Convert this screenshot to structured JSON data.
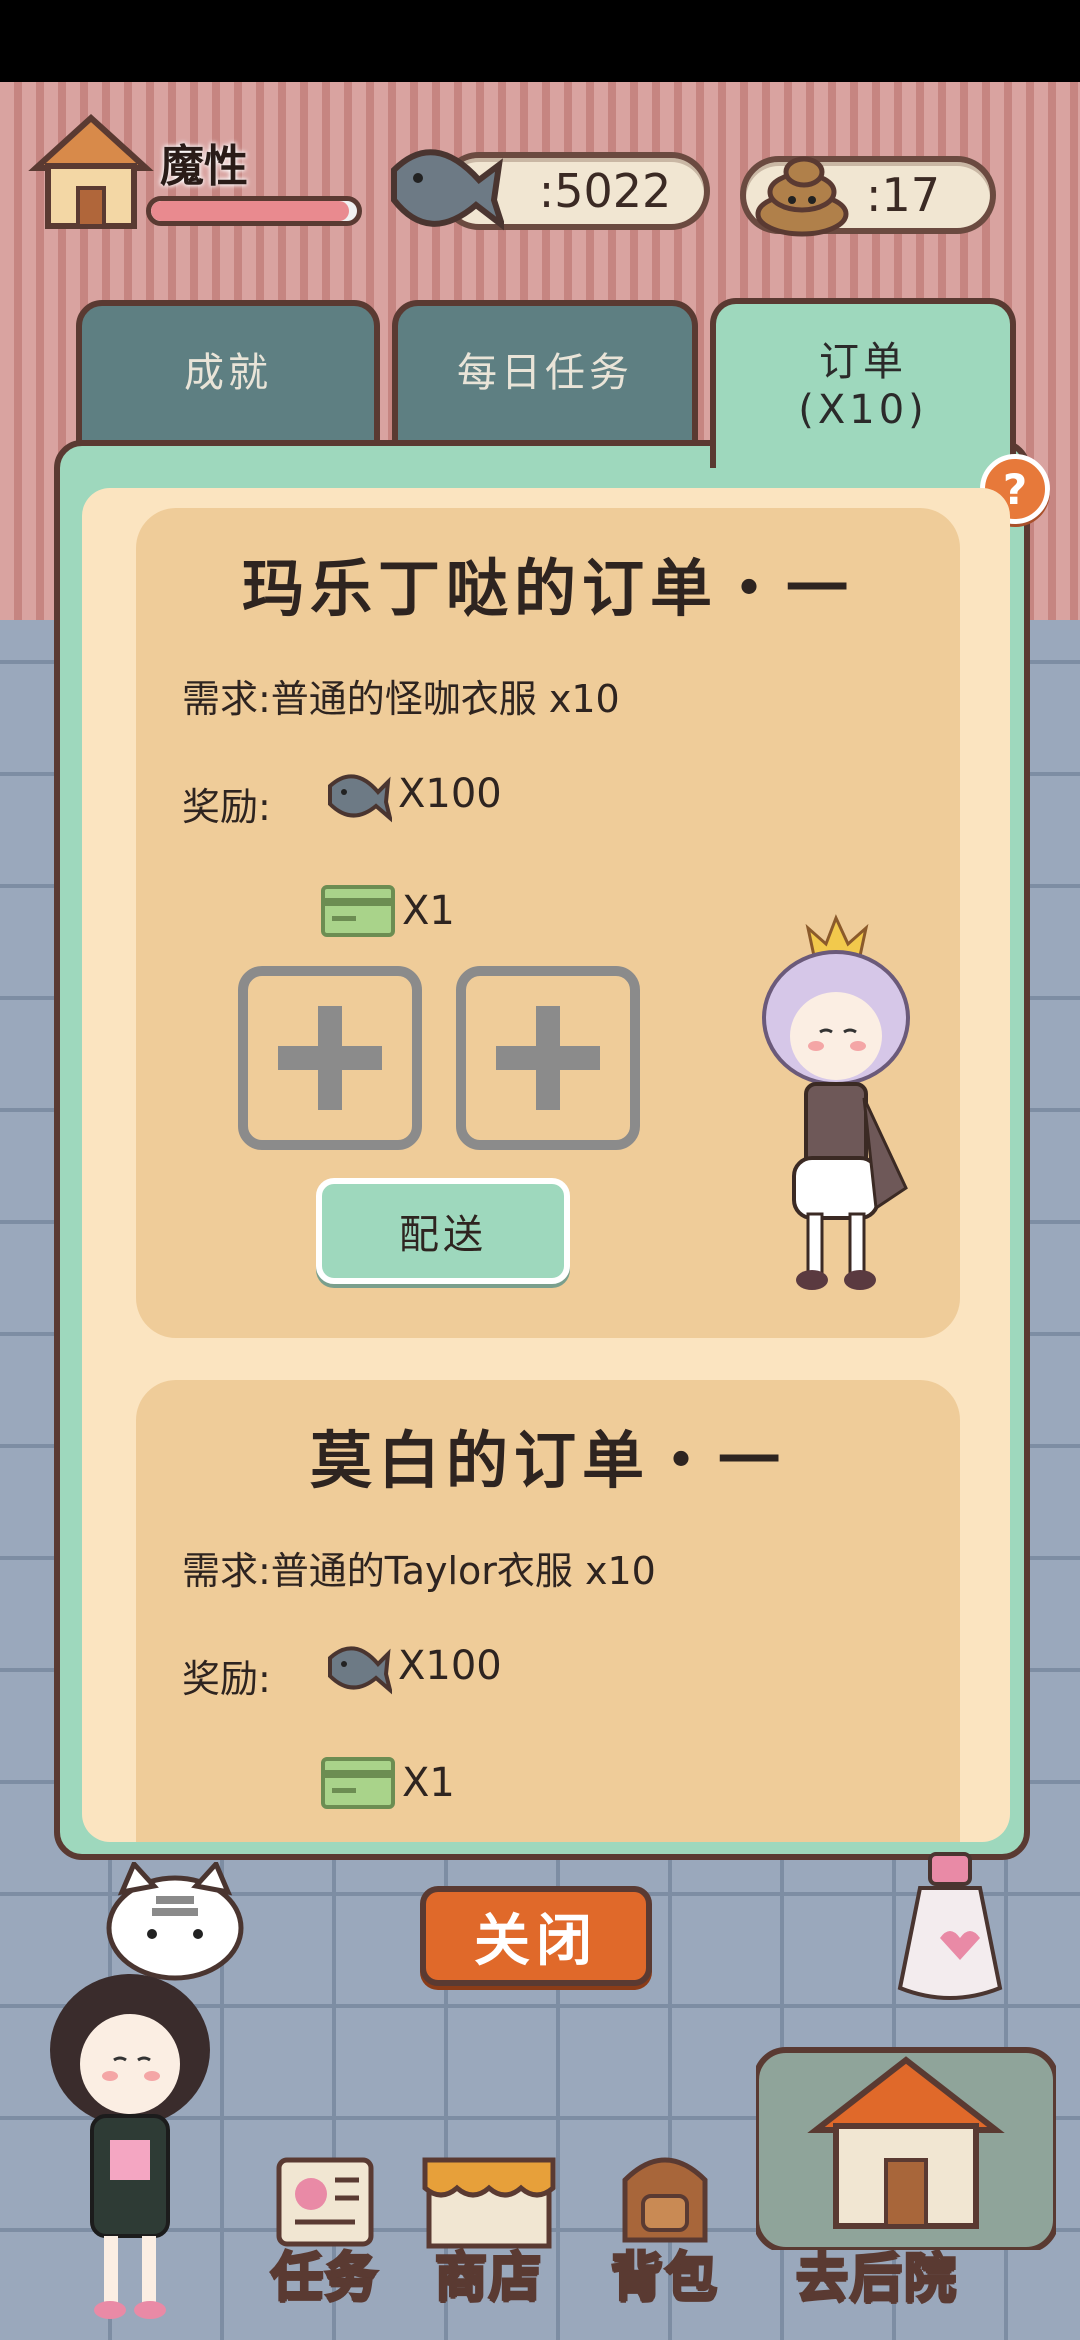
{
  "player": {
    "name": "魔性",
    "hp_fraction": 0.96
  },
  "resources": {
    "fish": ":5022",
    "poop": ":17"
  },
  "tabs": [
    {
      "label": "成就",
      "active": false
    },
    {
      "label": "每日任务",
      "active": false
    },
    {
      "label": "订单\n(X10)",
      "active": true
    }
  ],
  "help": {
    "label": "?"
  },
  "orders": [
    {
      "title": "玛乐丁哒的订单・一",
      "requirement": "需求:普通的怪咖衣服 x10",
      "reward_label": "奖励:",
      "reward_fish": "X100",
      "reward_ticket": "X1",
      "deliver_label": "配送"
    },
    {
      "title": "莫白的订单・一",
      "requirement": "需求:普通的Taylor衣服 x10",
      "reward_label": "奖励:",
      "reward_fish": "X100",
      "reward_ticket": "X1"
    }
  ],
  "close_label": "关闭",
  "nav": {
    "tasks": "任务",
    "shop": "商店",
    "bag": "背包",
    "backyard": "去后院"
  },
  "colors": {
    "panel_green": "#9ed8bd",
    "card_tan": "#efcc99",
    "close_orange": "#e0692a",
    "inactive_tab": "#5e7f82"
  }
}
